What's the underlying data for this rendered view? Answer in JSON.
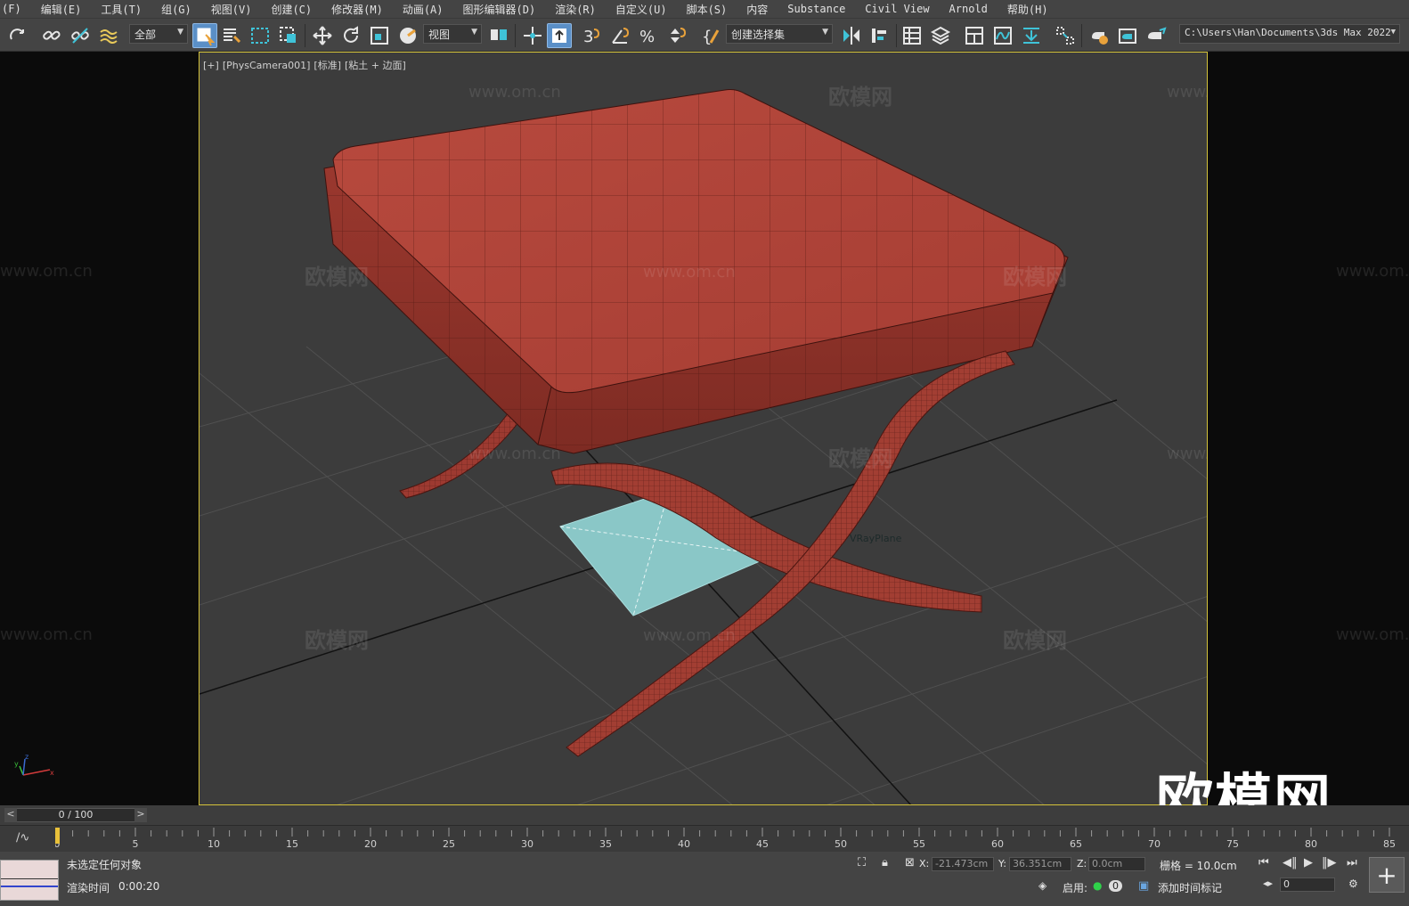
{
  "menu": [
    "(F)",
    "编辑(E)",
    "工具(T)",
    "组(G)",
    "视图(V)",
    "创建(C)",
    "修改器(M)",
    "动画(A)",
    "图形编辑器(D)",
    "渲染(R)",
    "自定义(U)",
    "脚本(S)",
    "内容",
    "Substance",
    "Civil View",
    "Arnold",
    "帮助(H)"
  ],
  "toolbar": {
    "selection_filter": "全部",
    "ref_coord": "视图",
    "named_selection": "创建选择集",
    "project_path": "C:\\Users\\Han\\Documents\\3ds Max 2022"
  },
  "viewport": {
    "label_plus": "[+]",
    "label_camera": "[PhysCamera001]",
    "label_mode": "[标准]",
    "label_shading": "[粘土 + 边面]",
    "object_label": "VRayPlane"
  },
  "watermarks": {
    "cn": "欧模网",
    "url": "www.om.cn",
    "logo": "欧模网"
  },
  "timeslider": {
    "position": "0 / 100",
    "prev": "<",
    "next": ">"
  },
  "trackbar": {
    "ticks": [
      "0",
      "5",
      "10",
      "15",
      "20",
      "25",
      "30",
      "35",
      "40",
      "45",
      "50",
      "55",
      "60",
      "65",
      "70",
      "75",
      "80",
      "85"
    ]
  },
  "status": {
    "selection_msg": "未选定任何对象",
    "render_time_label": "渲染时间",
    "render_time": "0:00:20",
    "x_label": "X:",
    "x_value": "-21.473cm",
    "y_label": "Y:",
    "y_value": "36.351cm",
    "z_label": "Z:",
    "z_value": "0.0cm",
    "grid": "栅格 = 10.0cm",
    "enable_label": "启用:",
    "enable_count": "0",
    "add_time_tag": "添加时间标记",
    "frame_value": "0"
  },
  "colors": {
    "viewport_border": "#d4c23a",
    "stool": "#b3463b",
    "vrayplane": "#8ac7c7",
    "active_tool": "#5a8fc7"
  }
}
